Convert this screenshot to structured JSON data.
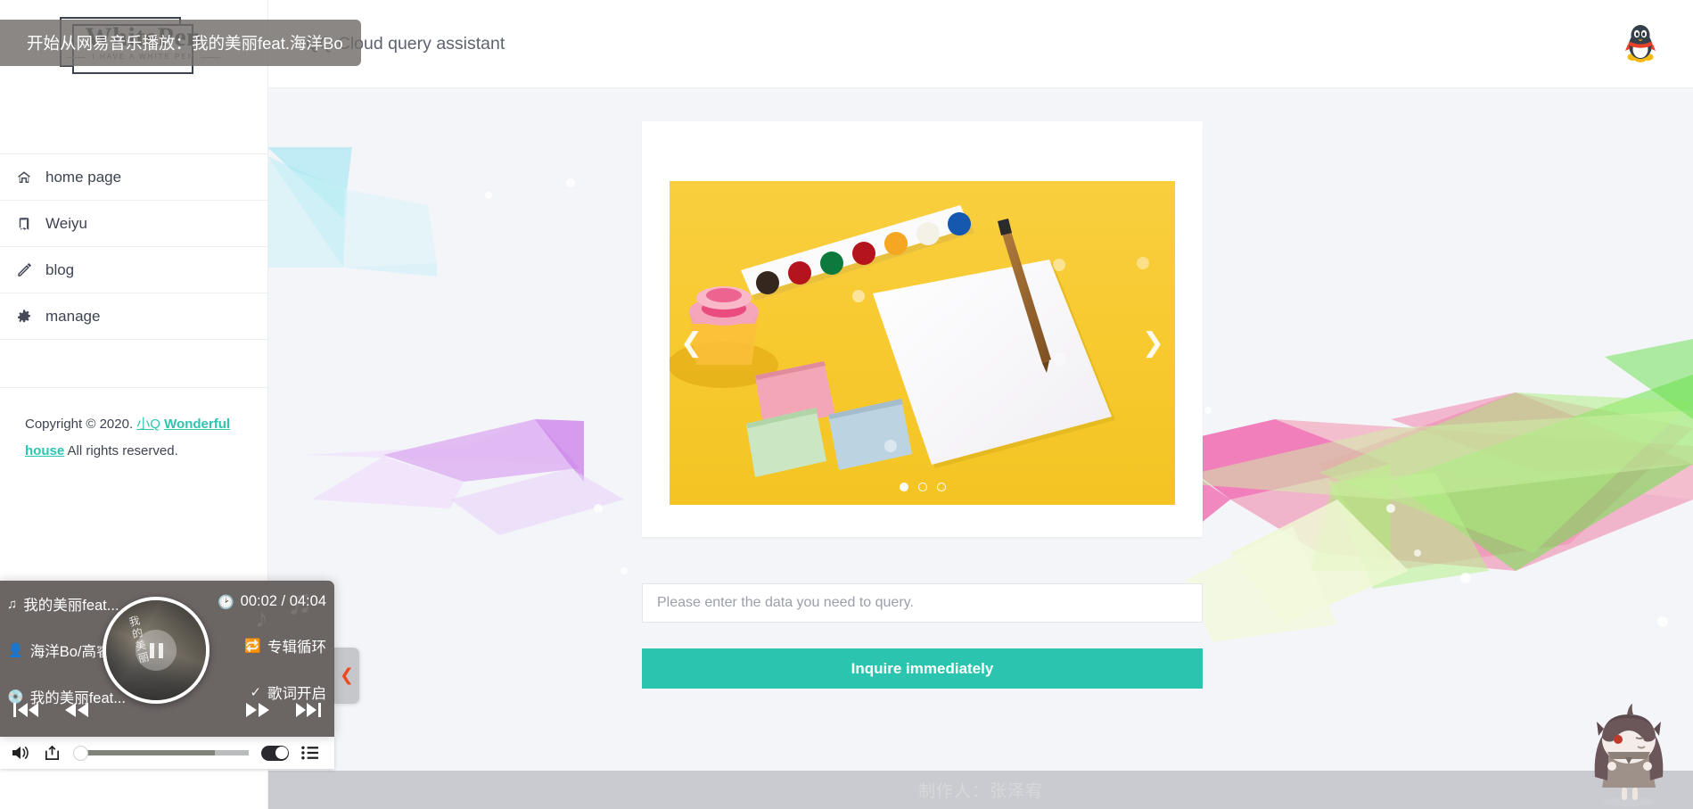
{
  "sidebar": {
    "logo": {
      "name": "WhitePen",
      "tagline": "I HAVE A WHITE PEN"
    },
    "items": [
      {
        "label": "home page",
        "icon": "home-icon"
      },
      {
        "label": "Weiyu",
        "icon": "book-icon"
      },
      {
        "label": "blog",
        "icon": "pencil-icon"
      },
      {
        "label": "manage",
        "icon": "gear-icon"
      }
    ],
    "footer": {
      "prefix": "Copyright © 2020. ",
      "owner": "小Q",
      "house": "Wonderful house",
      "suffix": " All rights reserved."
    }
  },
  "header": {
    "title": "QQ Cloud query assistant",
    "mascot_icon": "qq-penguin-icon"
  },
  "toast": {
    "message": "开始从网易音乐播放：我的美丽feat.海洋Bo"
  },
  "carousel": {
    "prev_icon": "chevron-left-icon",
    "next_icon": "chevron-right-icon",
    "slide_count": 3,
    "active_index": 0,
    "slide_alt": "watercolor paint set on yellow background"
  },
  "query": {
    "placeholder": "Please enter the data you need to query.",
    "value": "",
    "button_label": "Inquire immediately"
  },
  "page_footer": {
    "text": "制作人：张泽宥"
  },
  "player": {
    "title": "我的美丽feat...",
    "artist": "海洋Bo/高睿",
    "album": "我的美丽feat...",
    "time": "00:02 / 04:04",
    "loop_mode": "专辑循环",
    "lyrics_state": "歌词开启",
    "album_art_text": "我的美丽",
    "icons": {
      "title": "music-note-icon",
      "artist": "user-icon",
      "album": "disc-icon",
      "time": "clock-icon",
      "loop": "repeat-icon",
      "lyrics": "check-circle-icon",
      "first": "skip-start-icon",
      "prev": "rewind-icon",
      "next": "fast-forward-icon",
      "last": "skip-end-icon",
      "volume": "volume-icon",
      "share": "share-icon",
      "playlist": "playlist-icon",
      "toggle": "toggle-switch-icon"
    },
    "volume_percent": 77,
    "collapse_icon": "chevron-left-icon"
  },
  "live2d": {
    "name": "anime-mascot-widget"
  },
  "colors": {
    "accent": "#2bc4ae",
    "link": "#2ec4b1",
    "page_bg": "#f4f5f9",
    "player_bg": "#605958",
    "collapse_arrow": "#f04a20",
    "slide_yellow": "#f7c92e"
  }
}
